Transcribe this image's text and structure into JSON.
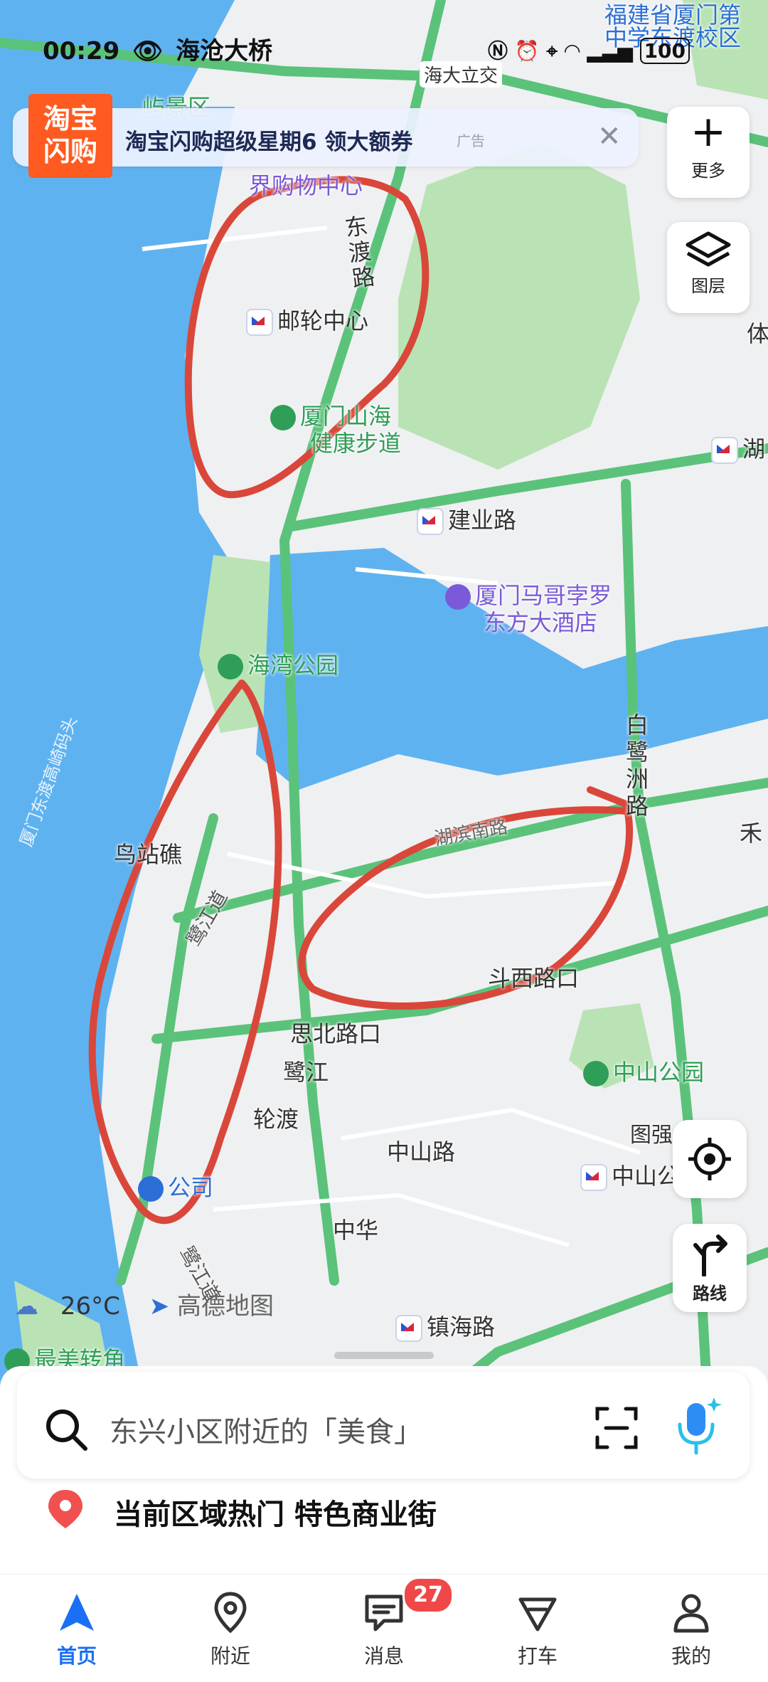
{
  "status_bar": {
    "time": "00:29",
    "location": "海沧大桥",
    "battery": "100"
  },
  "ad": {
    "logo_line1": "淘宝",
    "logo_line2": "闪购",
    "text": "淘宝闪购超级星期6 领大额券",
    "tag": "广告",
    "close": "✕"
  },
  "map": {
    "labels": {
      "school": "福建省厦门第",
      "school2": "中学东渡校区",
      "interchange": "海大立交",
      "scenic": "屿景区",
      "mall": "界购物中心",
      "dongdu_road": "东渡路",
      "cruise_center": "邮轮中心",
      "trail1": "厦门山海",
      "trail2": "健康步道",
      "jianye_road": "建业路",
      "hotel1": "厦门马哥孛罗",
      "hotel2": "东方大酒店",
      "haiwan_park": "海湾公园",
      "bailuzhou_road": "白鹭洲路",
      "hubin_south": "湖滨南路",
      "niaozhanjiao": "鸟站礁",
      "lujiang_dao": "鹭江道",
      "dou_xi": "斗西路口",
      "sibei": "思北路口",
      "lujiang": "鹭江",
      "zhongshan_park": "中山公园",
      "lundu": "轮渡",
      "zhongshan_road": "中山路",
      "zhonghua": "中华",
      "company": "公司",
      "lujiang_dao2": "鹭江道",
      "zhenhai_road": "镇海路",
      "zuimei": "最美转角",
      "tuqiang": "图强",
      "zhongshan_metro": "中山公",
      "hu": "湖",
      "ti": "体",
      "he": "禾",
      "xiamen_ferry": "厦门东渡高崎码头"
    }
  },
  "buttons": {
    "more": "更多",
    "layers": "图层",
    "route": "路线"
  },
  "weather": {
    "temp": "26°C",
    "brand": "高德地图"
  },
  "search": {
    "placeholder": "东兴小区附近的「美食」"
  },
  "hot": {
    "text": "当前区域热门 特色商业街"
  },
  "nav": {
    "items": [
      {
        "label": "首页"
      },
      {
        "label": "附近"
      },
      {
        "label": "消息"
      },
      {
        "label": "打车"
      },
      {
        "label": "我的"
      }
    ],
    "messages_badge": "27"
  },
  "colors": {
    "accent": "#1a6ff5",
    "road": "#5bc27a",
    "water": "#5fb2f0",
    "annotation": "#d9473a"
  }
}
